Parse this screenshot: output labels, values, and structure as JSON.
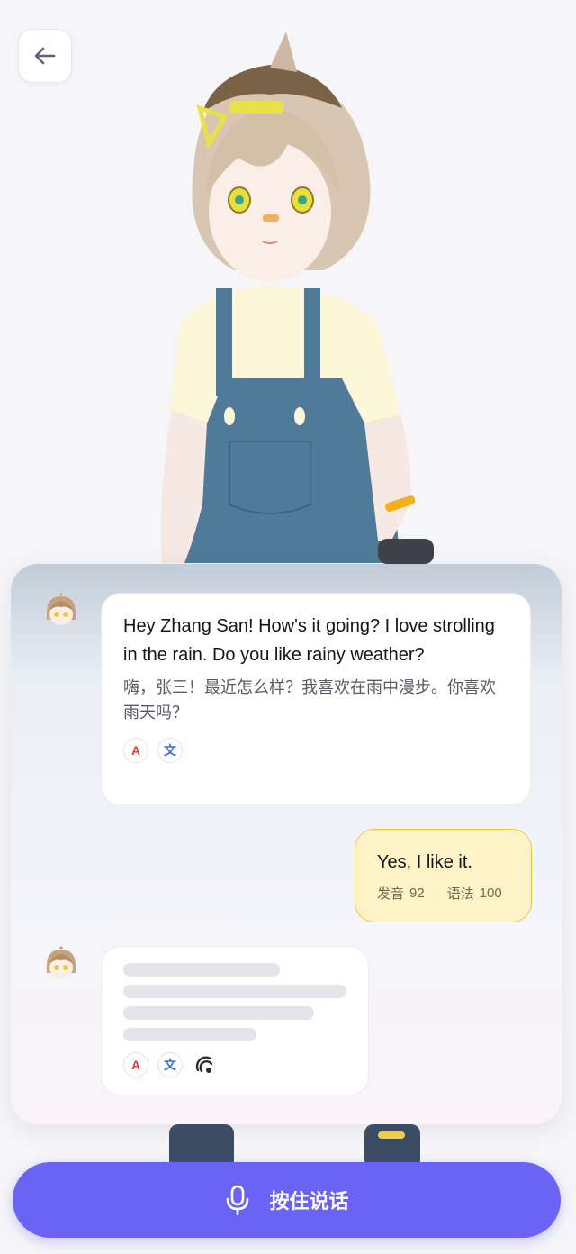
{
  "header": {
    "back_icon": "arrow-left-icon"
  },
  "messages": [
    {
      "role": "assistant",
      "text_en": "Hey Zhang San! How's it going? I love strolling in the rain. Do you like rainy weather?",
      "text_zh": "嗨，张三！最近怎么样？我喜欢在雨中漫步。你喜欢雨天吗？",
      "tools": [
        "A",
        "文"
      ]
    },
    {
      "role": "user",
      "text": "Yes, I like it.",
      "pronunciation_label": "发音",
      "pronunciation_score": "92",
      "grammar_label": "语法",
      "grammar_score": "100"
    },
    {
      "role": "assistant",
      "state": "loading",
      "tools": [
        "A",
        "文"
      ],
      "extra_icon": "audio-playing-icon"
    }
  ],
  "talk_button": {
    "label": "按住说话",
    "icon": "microphone-icon"
  },
  "colors": {
    "primary": "#6a63f4",
    "user_bubble": "#fdf3c6",
    "user_bubble_border": "#f3c23a",
    "translate_icon": "#3b6fe0",
    "grammar_icon": "#e23a3a"
  }
}
